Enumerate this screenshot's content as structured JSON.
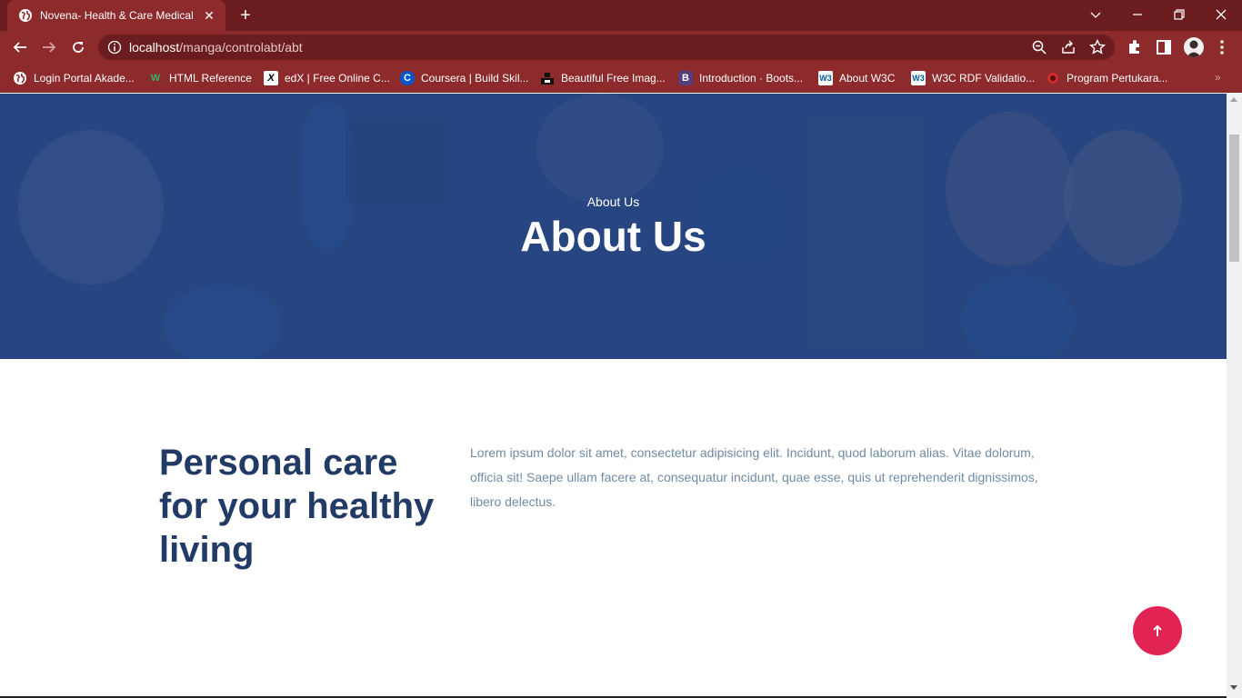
{
  "browser": {
    "tab_title": "Novena- Health & Care Medical",
    "url_host": "localhost",
    "url_path": "/manga/controlabt/abt",
    "accent_color": "#8c2a2c",
    "bookmarks": [
      {
        "label": "Login Portal Akade...",
        "icon": "globe-icon"
      },
      {
        "label": "HTML Reference",
        "icon": "w-icon"
      },
      {
        "label": "edX | Free Online C...",
        "icon": "edx-icon"
      },
      {
        "label": "Coursera | Build Skil...",
        "icon": "coursera-icon"
      },
      {
        "label": "Beautiful Free Imag...",
        "icon": "unsplash-icon"
      },
      {
        "label": "Introduction · Boots...",
        "icon": "bootstrap-icon"
      },
      {
        "label": "About W3C",
        "icon": "w3c-icon"
      },
      {
        "label": "W3C RDF Validatio...",
        "icon": "w3c-icon"
      },
      {
        "label": "Program Pertukara...",
        "icon": "program-icon"
      }
    ],
    "bookmarks_more": "»"
  },
  "page": {
    "hero": {
      "subtitle": "About Us",
      "title": "About Us"
    },
    "about": {
      "heading": "Personal care for your healthy living",
      "text": "Lorem ipsum dolor sit amet, consectetur adipisicing elit. Incidunt, quod laborum alias. Vitae dolorum, officia sit! Saepe ullam facere at, consequatur incidunt, quae esse, quis ut reprehenderit dignissimos, libero delectus."
    },
    "scroll_top_icon": "arrow-up-icon",
    "colors": {
      "hero": "#2e4a80",
      "heading": "#223a66",
      "body_text": "#6f8ba4",
      "scroll_button": "#e12454"
    }
  }
}
